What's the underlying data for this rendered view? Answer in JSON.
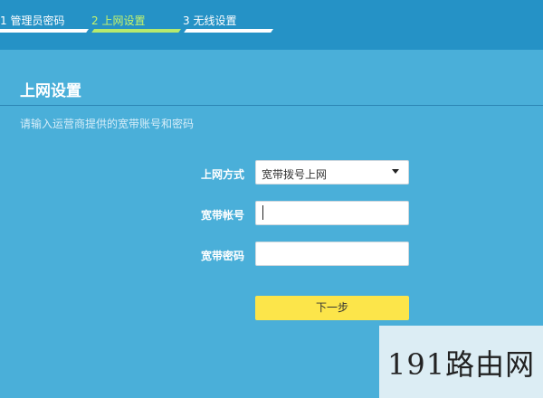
{
  "steps": [
    {
      "label": "1 管理员密码",
      "active": false
    },
    {
      "label": "2 上网设置",
      "active": true
    },
    {
      "label": "3 无线设置",
      "active": false
    }
  ],
  "section": {
    "title": "上网设置",
    "hint": "请输入运营商提供的宽带账号和密码"
  },
  "form": {
    "conn_type_label": "上网方式",
    "conn_type_value": "宽带拨号上网",
    "account_label": "宽带帐号",
    "account_value": "",
    "password_label": "宽带密码",
    "password_value": ""
  },
  "next_button": "下一步",
  "watermark": "191路由网",
  "colors": {
    "background": "#4aafd9",
    "topbar": "#2592c6",
    "active_step": "#c7f56a",
    "next_button": "#fce54a"
  }
}
